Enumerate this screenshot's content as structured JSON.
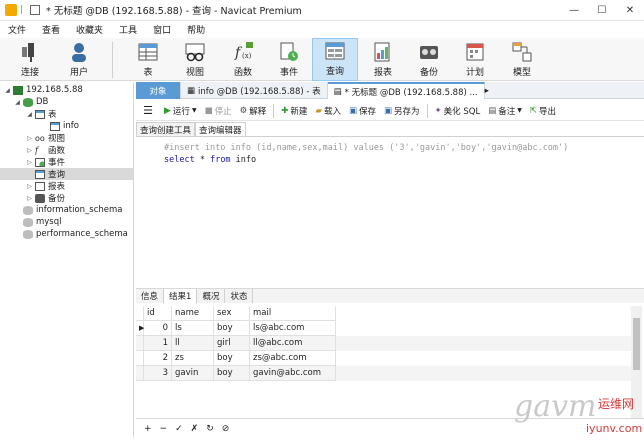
{
  "window": {
    "title": "* 无标题 @DB (192.168.5.88) - 查询 - Navicat Premium"
  },
  "menu": [
    "文件",
    "查看",
    "收藏夹",
    "工具",
    "窗口",
    "帮助"
  ],
  "toolbar": {
    "connect": "连接",
    "user": "用户",
    "table": "表",
    "view": "视图",
    "function": "函数",
    "event": "事件",
    "query": "查询",
    "report": "报表",
    "backup": "备份",
    "schedule": "计划",
    "model": "模型"
  },
  "sidebar": {
    "connection": "192.168.5.88",
    "db": "DB",
    "tables_group": "表",
    "table_info": "info",
    "views": "视图",
    "functions": "函数",
    "events": "事件",
    "queries": "查询",
    "reports": "报表",
    "backups": "备份",
    "schema1": "information_schema",
    "schema2": "mysql",
    "schema3": "performance_schema"
  },
  "tabs": {
    "objects": "对象",
    "tab1": "info @DB (192.168.5.88) - 表",
    "tab2": "* 无标题 @DB (192.168.5.88) ..."
  },
  "query_toolbar": {
    "run": "运行",
    "stop": "停止",
    "explain": "解释",
    "new": "新建",
    "load": "载入",
    "save": "保存",
    "save_as": "另存为",
    "beautify": "美化 SQL",
    "notes": "备注",
    "export": "导出"
  },
  "editor_tabs": {
    "builder": "查询创建工具",
    "editor": "查询编辑器"
  },
  "editor": {
    "line1": "#insert into info (id,name,sex,mail) values ('3','gavin','boy','gavin@abc.com')",
    "line2_kw1": "select",
    "line2_rest": " * ",
    "line2_kw2": "from",
    "line2_tail": " info"
  },
  "result_tabs": {
    "info": "信息",
    "result1": "结果1",
    "overview": "概况",
    "status": "状态"
  },
  "grid": {
    "columns": [
      "id",
      "name",
      "sex",
      "mail"
    ],
    "rows": [
      [
        "0",
        "ls",
        "boy",
        "ls@abc.com"
      ],
      [
        "1",
        "ll",
        "girl",
        "ll@abc.com"
      ],
      [
        "2",
        "zs",
        "boy",
        "zs@abc.com"
      ],
      [
        "3",
        "gavin",
        "boy",
        "gavin@abc.com"
      ]
    ]
  },
  "bottom": {
    "add": "+",
    "remove": "−",
    "apply": "✓",
    "cancel": "✗",
    "refresh": "↻",
    "stop": "⊘"
  },
  "watermark": {
    "brand": "运维网",
    "site": "iyunv.com"
  }
}
